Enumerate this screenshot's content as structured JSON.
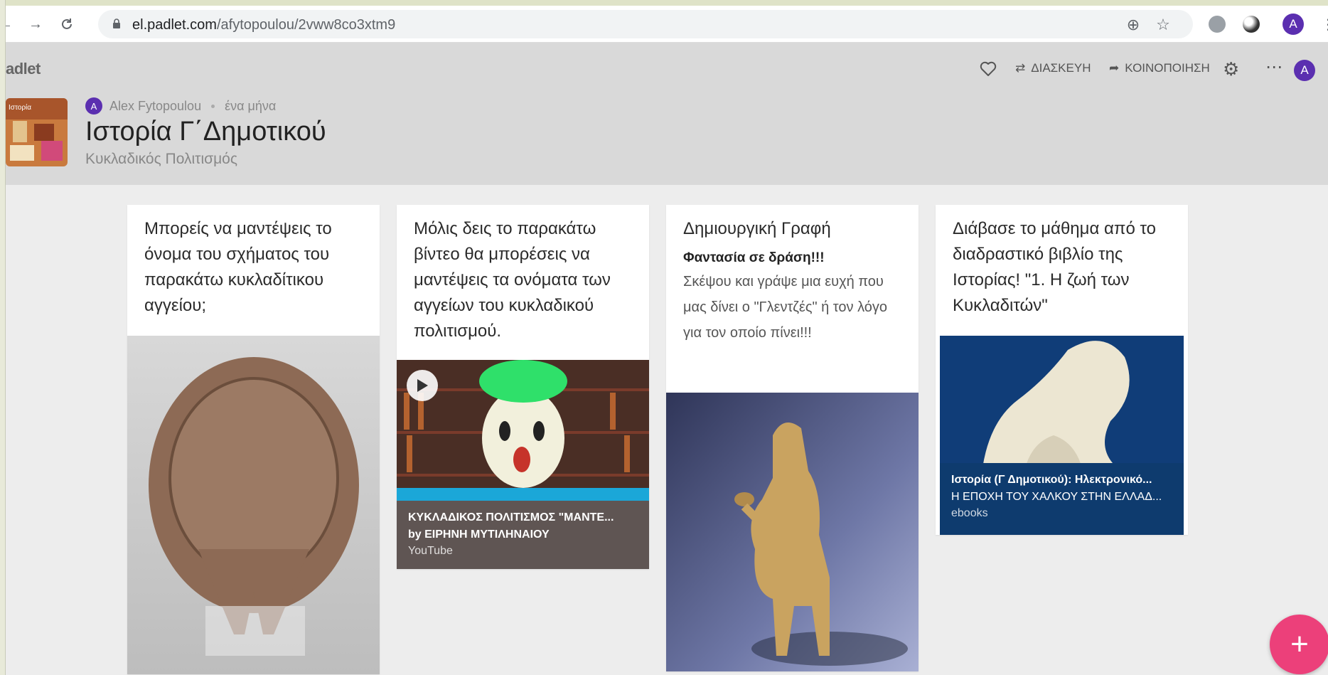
{
  "browser": {
    "url_host": "el.padlet.com",
    "url_path": "/afytopoulou/2vww8co3xtm9",
    "profile_initial": "A"
  },
  "padlet": {
    "brand": "adlet",
    "actions": {
      "remix_label": "ΔΙΑΣΚΕΥΗ",
      "share_label": "ΚΟΙΝΟΠΟΙΗΣΗ"
    },
    "user_initial": "A",
    "author_initial": "A",
    "author": "Alex Fytopoulou",
    "time_ago": "ένα μήνα",
    "title": "Ιστορία Γ΄Δημοτικού",
    "subtitle": "Κυκλαδικός Πολιτισμός",
    "thumb_text": "Ιστορία"
  },
  "cards": [
    {
      "title": "Μπορείς να μαντέψεις το όνομα του σχήματος του παρακάτω κυκλαδίτικου αγγείου;",
      "media": "frying-pan-vessel-image"
    },
    {
      "title": "Μόλις δεις το παρακάτω βίντεο θα μπορέσεις να μαντέψεις τα ονόματα των αγγείων του κυκλαδικού πολιτισμού.",
      "link_title": "ΚΥΚΛΑΔΙΚΟΣ ΠΟΛΙΤΙΣΜΟΣ \"ΜΑΝΤΕ...",
      "link_author": "by ΕΙΡΗΝΗ ΜΥΤΙΛΗΝΑΙΟΥ",
      "link_source": "YouTube"
    },
    {
      "title": "Δημιουργική Γραφή",
      "subhead": "Φαντασία σε δράση!!!",
      "body": "Σκέψου και γράψε μια ευχή που μας δίνει  ο \"Γλεντζές\" ή τον λόγο για τον οποίο πίνει!!!",
      "media": "cycladic-drinker-figurine-image"
    },
    {
      "title": "Διάβασε το μάθημα από το διαδραστικό βιβλίο της Ιστορίας!  \"1. Η ζωή των Κυκλαδιτών\"",
      "link_title": "Ιστορία (Γ Δημοτικού): Ηλεκτρονικό...",
      "link_subtitle": "Η ΕΠΟΧΗ ΤΟΥ ΧΑΛΚΟΥ ΣΤΗΝ ΕΛΛΑΔ...",
      "link_source": "ebooks"
    }
  ],
  "fab_label": "+"
}
